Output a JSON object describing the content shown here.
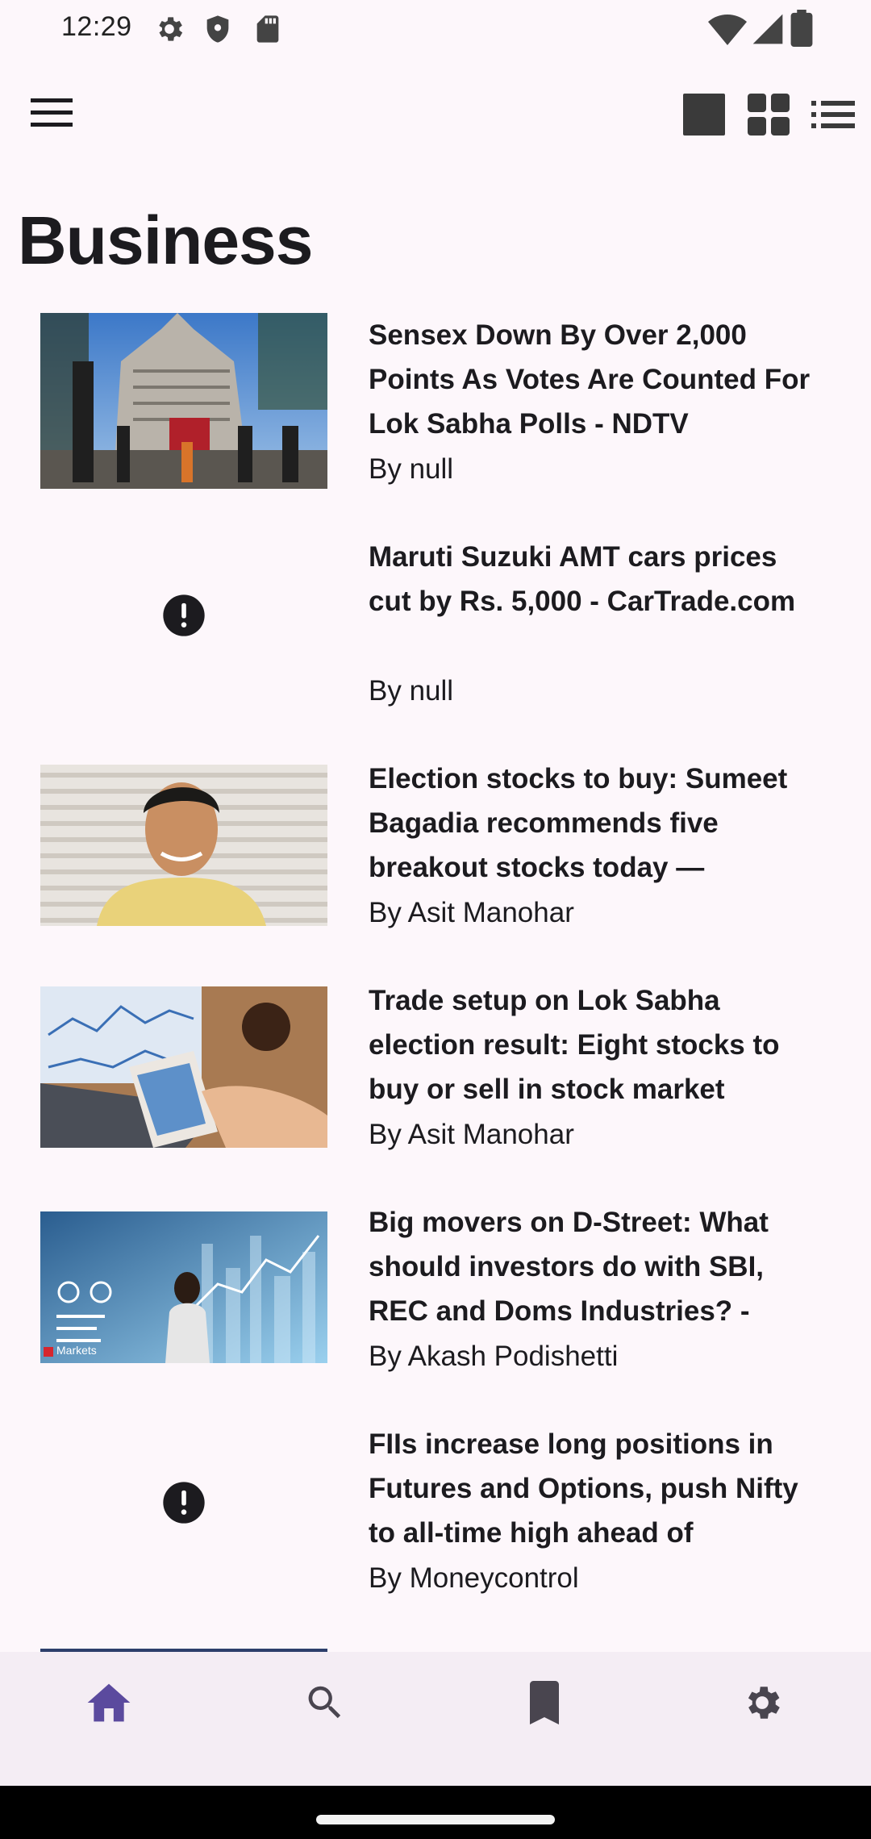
{
  "status_bar": {
    "time": "12:29",
    "left_icons": [
      "settings-gear-icon",
      "shield-icon",
      "sd-card-icon"
    ],
    "right_icons": [
      "wifi-icon",
      "cellular-signal-icon",
      "battery-icon"
    ]
  },
  "top_bar": {
    "menu_icon": "hamburger-menu-icon",
    "view_options": [
      "single-card-view-icon",
      "grid-view-icon",
      "list-view-icon"
    ]
  },
  "page": {
    "title": "Business"
  },
  "articles": [
    {
      "title": "Sensex Down By Over 2,000 Points As Votes Are Counted For Lok Sabha Polls - NDTV",
      "author": "By null",
      "image": "stock-exchange-building-photo"
    },
    {
      "title": "Maruti Suzuki AMT cars prices cut by Rs. 5,000 - CarTrade.com",
      "author": "By null",
      "image": "error-icon"
    },
    {
      "title": "Election stocks to buy: Sumeet Bagadia recommends five breakout stocks today —",
      "author": "By Asit Manohar",
      "image": "man-portrait-photo"
    },
    {
      "title": "Trade setup on Lok Sabha election result: Eight stocks to buy or sell in stock market",
      "author": "By Asit Manohar",
      "image": "phone-laptop-trading-photo"
    },
    {
      "title": "Big movers on D-Street: What should investors do with SBI, REC and Doms Industries? -",
      "author": "By Akash Podishetti",
      "image": "investor-charts-photo",
      "image_caption": "Markets"
    },
    {
      "title": "FIIs increase long positions in Futures and Options, push Nifty to all-time high ahead of",
      "author": "By Moneycontrol",
      "image": "error-icon"
    }
  ],
  "bottom_nav": {
    "items": [
      {
        "name": "home",
        "icon": "home-icon",
        "active": true
      },
      {
        "name": "search",
        "icon": "search-icon",
        "active": false
      },
      {
        "name": "bookmarks",
        "icon": "bookmark-icon",
        "active": false
      },
      {
        "name": "settings",
        "icon": "settings-icon",
        "active": false
      }
    ]
  },
  "colors": {
    "background": "#fdf7fb",
    "nav_background": "#f4edf4",
    "active_nav": "#5b4a9e",
    "inactive_nav": "#49454f",
    "text": "#1c1b1f"
  }
}
